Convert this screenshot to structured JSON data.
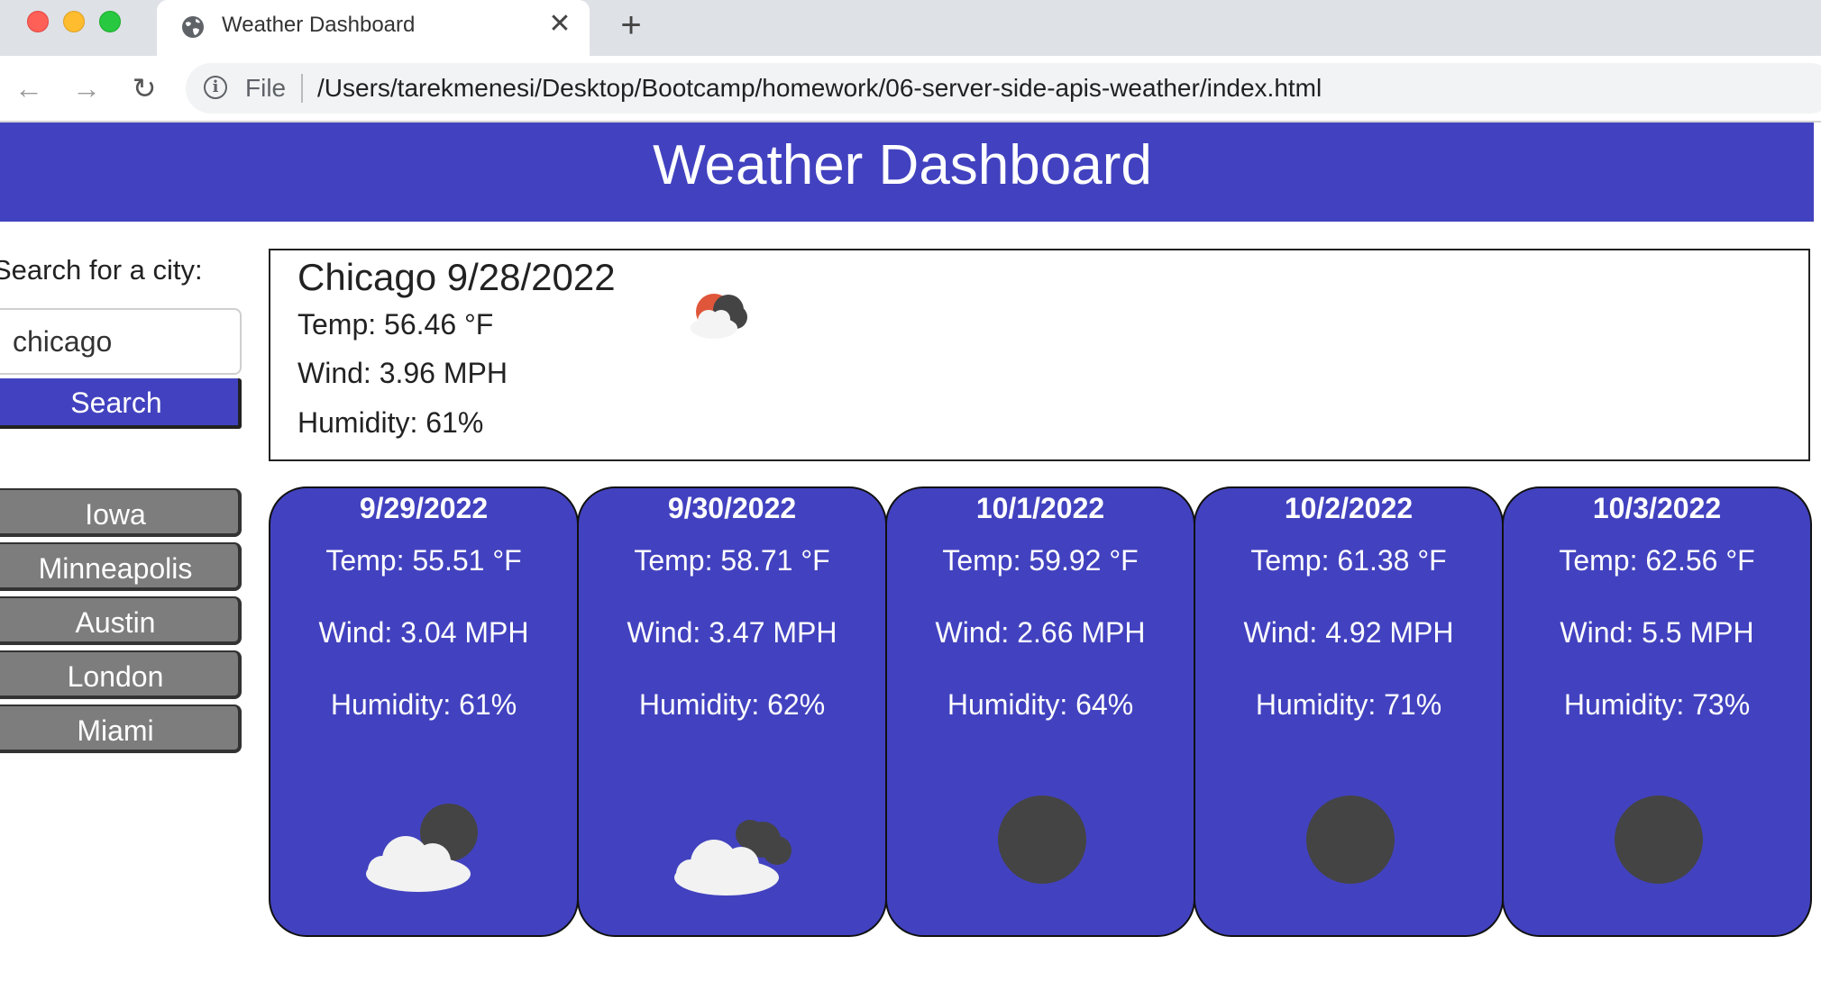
{
  "browser": {
    "tab_title": "Weather Dashboard",
    "tab_close": "✕",
    "new_tab": "+",
    "back": "←",
    "forward": "→",
    "reload": "↻",
    "info_icon": "i",
    "file_label": "File",
    "url": "/Users/tarekmenesi/Desktop/Bootcamp/homework/06-server-side-apis-weather/index.html"
  },
  "header": {
    "title": "Weather Dashboard"
  },
  "search": {
    "label": "Search for a city:",
    "value": "chicago",
    "button_label": "Search"
  },
  "history": [
    {
      "label": "Iowa"
    },
    {
      "label": "Minneapolis"
    },
    {
      "label": "Austin"
    },
    {
      "label": "London"
    },
    {
      "label": "Miami"
    }
  ],
  "current": {
    "city_date": "Chicago 9/28/2022",
    "temp": "Temp: 56.46 °F",
    "wind": "Wind: 3.96 MPH",
    "humidity": "Humidity: 61%",
    "icon": "partly-cloudy-night-icon"
  },
  "forecast": [
    {
      "date": "9/29/2022",
      "temp": "Temp: 55.51 °F",
      "wind": "Wind: 3.04 MPH",
      "humidity": "Humidity: 61%",
      "icon": "partly-cloudy-night-icon"
    },
    {
      "date": "9/30/2022",
      "temp": "Temp: 58.71 °F",
      "wind": "Wind: 3.47 MPH",
      "humidity": "Humidity: 62%",
      "icon": "broken-clouds-night-icon"
    },
    {
      "date": "10/1/2022",
      "temp": "Temp: 59.92 °F",
      "wind": "Wind: 2.66 MPH",
      "humidity": "Humidity: 64%",
      "icon": "clear-night-icon"
    },
    {
      "date": "10/2/2022",
      "temp": "Temp: 61.38 °F",
      "wind": "Wind: 4.92 MPH",
      "humidity": "Humidity: 71%",
      "icon": "clear-night-icon"
    },
    {
      "date": "10/3/2022",
      "temp": "Temp: 62.56 °F",
      "wind": "Wind: 5.5 MPH",
      "humidity": "Humidity: 73%",
      "icon": "clear-night-icon"
    }
  ],
  "colors": {
    "accent": "#4242c0",
    "history_button": "#7d7d7d",
    "moon": "#444444",
    "cloud": "#f2f2f2"
  }
}
